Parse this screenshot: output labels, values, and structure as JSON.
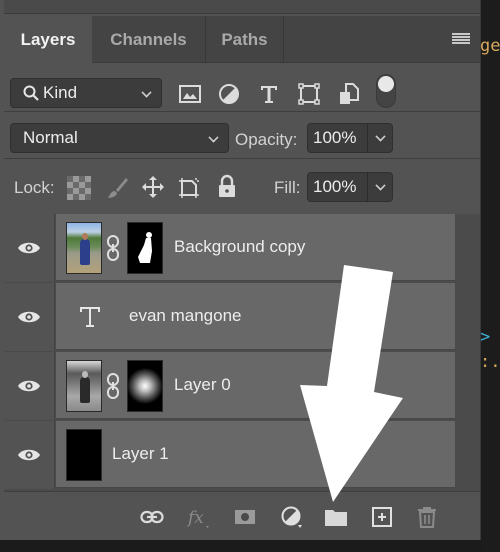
{
  "background_code": {
    "fragment_1": "ge",
    "fragment_2": ">",
    "fragment_3": ":."
  },
  "tabs": [
    {
      "label": "Layers",
      "active": true
    },
    {
      "label": "Channels",
      "active": false
    },
    {
      "label": "Paths",
      "active": false
    }
  ],
  "filter": {
    "kind_label": "Kind",
    "icons": [
      "pixel-layer-filter-icon",
      "adjustment-layer-filter-icon",
      "type-layer-filter-icon",
      "shape-layer-filter-icon",
      "smart-object-filter-icon",
      "filter-toggle-switch"
    ]
  },
  "blend": {
    "mode": "Normal",
    "opacity_label": "Opacity:",
    "opacity_value": "100%"
  },
  "lock": {
    "label": "Lock:",
    "icons": [
      "lock-transparent-pixels-icon",
      "lock-image-pixels-icon",
      "lock-position-icon",
      "lock-artboard-icon",
      "lock-all-icon"
    ],
    "fill_label": "Fill:",
    "fill_value": "100%"
  },
  "layers": [
    {
      "name": "Background copy",
      "type": "image-with-mask",
      "visible": true
    },
    {
      "name": "evan mangone",
      "type": "text",
      "visible": true
    },
    {
      "name": "Layer 0",
      "type": "image-with-mask",
      "visible": true
    },
    {
      "name": "Layer 1",
      "type": "fill",
      "visible": true
    }
  ],
  "bottom_toolbar": [
    "link-layers-icon",
    "layer-style-fx-icon",
    "add-mask-icon",
    "adjustment-layer-icon",
    "new-group-folder-icon",
    "new-layer-icon",
    "delete-layer-icon"
  ],
  "annotation": {
    "type": "arrow",
    "points_to": "new-group-folder-icon",
    "color": "#ffffff"
  },
  "colors": {
    "panel_bg": "#535353",
    "layer_row_bg": "#686868",
    "tab_bar_bg": "#444444",
    "input_bg": "#3c3c3c"
  }
}
